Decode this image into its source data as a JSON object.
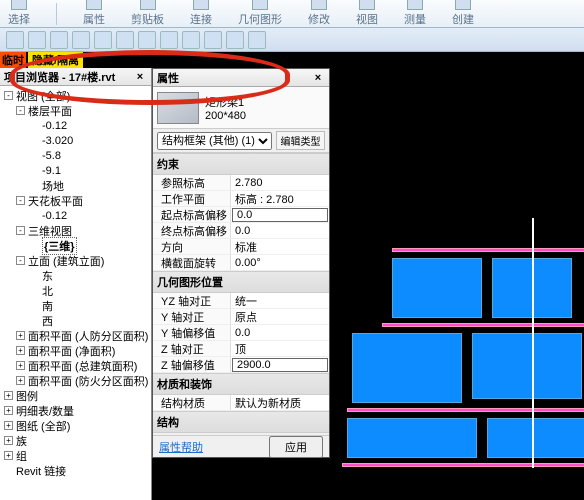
{
  "ribbon": {
    "groups": [
      {
        "label": "选择",
        "icons": 1
      },
      {
        "label": "属性",
        "icons": 1
      },
      {
        "label": "剪贴板",
        "icons": 1
      },
      {
        "label": "连接",
        "icons": 1
      },
      {
        "label": "几何图形",
        "icons": 1
      },
      {
        "label": "修改",
        "icons": 1
      },
      {
        "label": "视图",
        "icons": 1
      },
      {
        "label": "测量",
        "icons": 1
      },
      {
        "label": "创建",
        "icons": 1
      }
    ]
  },
  "hidebar": {
    "left": "临时",
    "button": "隐藏/隔离"
  },
  "project_browser": {
    "title_prefix": "项目浏览器",
    "file": "17#楼.rvt",
    "tree": [
      {
        "lvl": 0,
        "tw": "-",
        "txt": "视图 (全部)"
      },
      {
        "lvl": 1,
        "tw": "-",
        "txt": "楼层平面"
      },
      {
        "lvl": 2,
        "tw": "",
        "txt": "-0.12"
      },
      {
        "lvl": 2,
        "tw": "",
        "txt": "-3.020"
      },
      {
        "lvl": 2,
        "tw": "",
        "txt": "-5.8"
      },
      {
        "lvl": 2,
        "tw": "",
        "txt": "-9.1"
      },
      {
        "lvl": 2,
        "tw": "",
        "txt": "场地"
      },
      {
        "lvl": 1,
        "tw": "-",
        "txt": "天花板平面"
      },
      {
        "lvl": 2,
        "tw": "",
        "txt": "-0.12"
      },
      {
        "lvl": 1,
        "tw": "-",
        "txt": "三维视图"
      },
      {
        "lvl": 2,
        "tw": "",
        "txt": "{三维}",
        "sel": true
      },
      {
        "lvl": 1,
        "tw": "-",
        "txt": "立面 (建筑立面)"
      },
      {
        "lvl": 2,
        "tw": "",
        "txt": "东"
      },
      {
        "lvl": 2,
        "tw": "",
        "txt": "北"
      },
      {
        "lvl": 2,
        "tw": "",
        "txt": "南"
      },
      {
        "lvl": 2,
        "tw": "",
        "txt": "西"
      },
      {
        "lvl": 1,
        "tw": "+",
        "txt": "面积平面 (人防分区面积)"
      },
      {
        "lvl": 1,
        "tw": "+",
        "txt": "面积平面 (净面积)"
      },
      {
        "lvl": 1,
        "tw": "+",
        "txt": "面积平面 (总建筑面积)"
      },
      {
        "lvl": 1,
        "tw": "+",
        "txt": "面积平面 (防火分区面积)"
      },
      {
        "lvl": 0,
        "tw": "+",
        "txt": "图例"
      },
      {
        "lvl": 0,
        "tw": "+",
        "txt": "明细表/数量"
      },
      {
        "lvl": 0,
        "tw": "+",
        "txt": "图纸 (全部)"
      },
      {
        "lvl": 0,
        "tw": "+",
        "txt": "族"
      },
      {
        "lvl": 0,
        "tw": "+",
        "txt": "组"
      },
      {
        "lvl": 0,
        "tw": "",
        "txt": "Revit 链接"
      }
    ]
  },
  "properties": {
    "panel_title": "属性",
    "type_name": "矩形梁1",
    "type_dim": "200*480",
    "selector": "结构框架 (其他) (1)",
    "edit_type": "编辑类型",
    "sections": [
      {
        "title": "约束",
        "rows": [
          {
            "k": "参照标高",
            "v": "2.780"
          },
          {
            "k": "工作平面",
            "v": "标高 : 2.780"
          },
          {
            "k": "起点标高偏移",
            "v": "0.0",
            "boxed": true
          },
          {
            "k": "终点标高偏移",
            "v": "0.0"
          },
          {
            "k": "方向",
            "v": "标准"
          },
          {
            "k": "横截面旋转",
            "v": "0.00°"
          }
        ]
      },
      {
        "title": "几何图形位置",
        "rows": [
          {
            "k": "YZ 轴对正",
            "v": "统一"
          },
          {
            "k": "Y 轴对正",
            "v": "原点"
          },
          {
            "k": "Y 轴偏移值",
            "v": "0.0"
          },
          {
            "k": "Z 轴对正",
            "v": "顶"
          },
          {
            "k": "Z 轴偏移值",
            "v": "2900.0",
            "boxed": true
          }
        ]
      },
      {
        "title": "材质和装饰",
        "rows": [
          {
            "k": "结构材质",
            "v": "默认为新材质"
          }
        ]
      },
      {
        "title": "结构",
        "rows": []
      }
    ],
    "help": "属性帮助",
    "apply": "应用"
  }
}
